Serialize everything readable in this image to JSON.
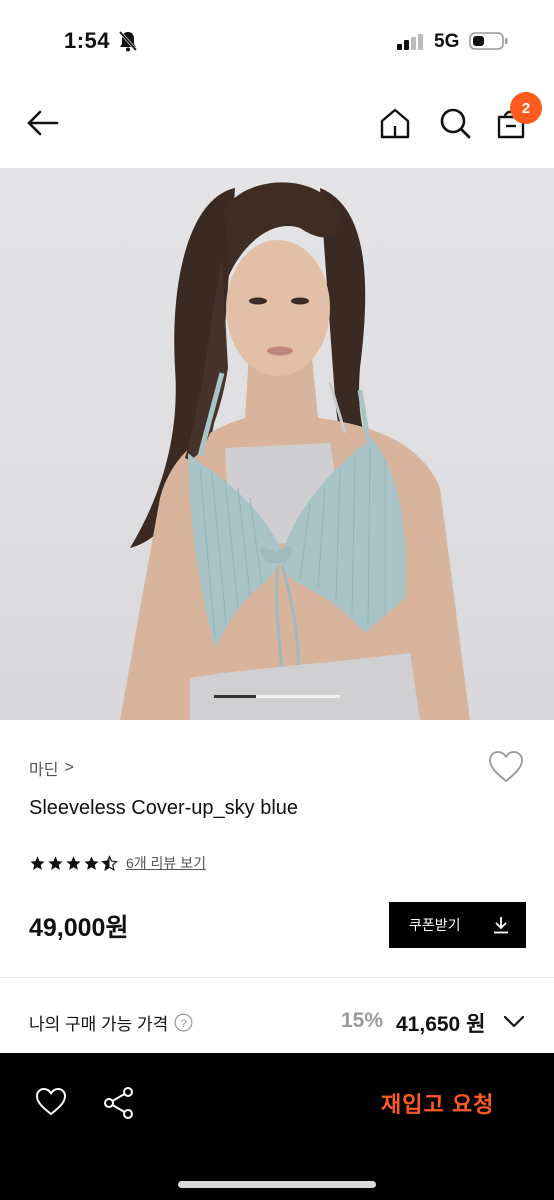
{
  "status": {
    "time": "1:54",
    "network": "5G",
    "icons": [
      "bell-off-icon",
      "signal-icon",
      "battery-icon"
    ]
  },
  "header": {
    "icons": [
      "back-arrow-icon",
      "home-icon",
      "search-icon",
      "cart-icon"
    ],
    "cart_count": "2"
  },
  "gallery": {
    "image": "model wearing sky blue sleeveless knit cover-up",
    "page_count": 3,
    "current_page": 1
  },
  "product": {
    "brand": "마딘",
    "brand_chevron": ">",
    "name": "Sleeveless Cover-up_sky blue",
    "rating": 4.5,
    "review_link": "6개 리뷰 보기",
    "price": "49,000원",
    "coupon_label": "쿠폰받기"
  },
  "my_price": {
    "label": "나의 구매 가능 가격",
    "help": "?",
    "discount": "15%",
    "final_price": "41,650 원"
  },
  "bottom_bar": {
    "restock_label": "재입고 요청",
    "icons": [
      "heart-icon",
      "share-icon"
    ]
  },
  "colors": {
    "accent": "#ff5a1f",
    "primary_text": "#111111",
    "muted_text": "#9a9a9a",
    "bottom_bar_bg": "#000000"
  }
}
